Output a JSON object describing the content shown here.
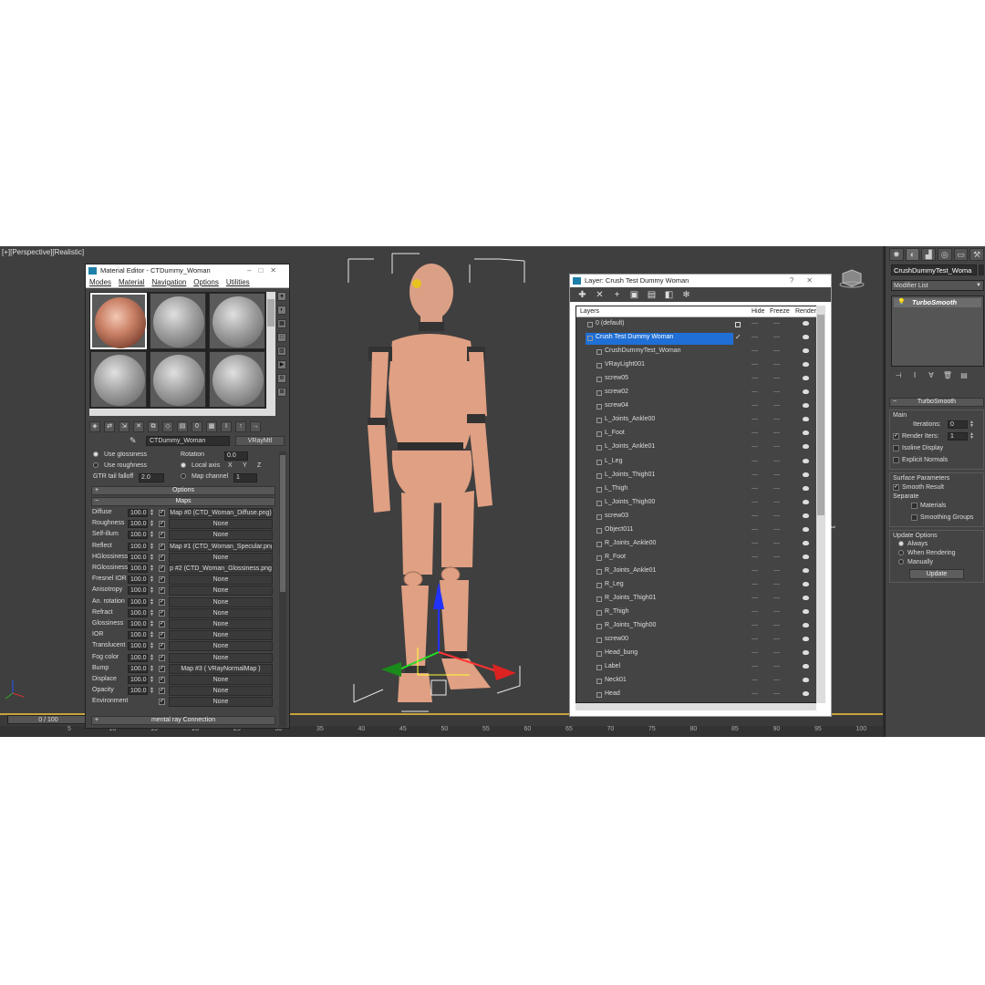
{
  "viewport": {
    "label": "[+][Perspective][Realistic]",
    "frame_counter": "0 / 100",
    "ruler_ticks": [
      "5",
      "10",
      "15",
      "20",
      "25",
      "30",
      "35",
      "40",
      "45",
      "50",
      "55",
      "60",
      "65",
      "70",
      "75",
      "80",
      "85",
      "90",
      "95",
      "100"
    ]
  },
  "command_panel": {
    "tabs": [
      "create-icon",
      "modify-icon",
      "hierarchy-icon",
      "motion-icon",
      "display-icon",
      "utilities-icon"
    ],
    "object_name": "CrushDummyTest_Woma",
    "modifier_list": "Modifier List",
    "stack_item": "TurboSmooth",
    "turbosmooth": {
      "title": "TurboSmooth",
      "main_label": "Main",
      "iterations_label": "Iterations:",
      "iterations_value": "0",
      "render_iters_label": "Render Iters:",
      "render_iters_value": "1",
      "isoline_label": "Isoline Display",
      "explicit_label": "Explicit Normals",
      "surface_label": "Surface Parameters",
      "smooth_result_label": "Smooth Result",
      "separate_label": "Separate",
      "materials_label": "Materials",
      "smoothing_groups_label": "Smoothing Groups",
      "update_options_label": "Update Options",
      "always_label": "Always",
      "when_rendering_label": "When Rendering",
      "manually_label": "Manually",
      "update_button": "Update"
    }
  },
  "material_editor": {
    "title": "Material Editor - CTDummy_Woman",
    "menu": [
      "Modes",
      "Material",
      "Navigation",
      "Options",
      "Utilities"
    ],
    "material_name": "CTDummy_Woman",
    "material_type": "VRayMtl",
    "use_glossiness": "Use glossiness",
    "use_roughness": "Use roughness",
    "rotation_label": "Rotation",
    "rotation_value": "0.0",
    "local_axis": "Local axis",
    "axes": [
      "X",
      "Y",
      "Z"
    ],
    "gtr_label": "GTR tail falloff",
    "gtr_value": "2.0",
    "map_channel_label": "Map channel",
    "map_channel_value": "1",
    "options_rollout": "Options",
    "maps_rollout": "Maps",
    "next_rollout": "mental ray Connection",
    "maps": [
      {
        "label": "Diffuse",
        "amount": "100.0",
        "map": "Map #0 (CTD_Woman_Diffuse.png)"
      },
      {
        "label": "Roughness",
        "amount": "100.0",
        "map": "None"
      },
      {
        "label": "Self-illum",
        "amount": "100.0",
        "map": "None"
      },
      {
        "label": "Reflect",
        "amount": "100.0",
        "map": "Map #1 (CTD_Woman_Specular.png)"
      },
      {
        "label": "HGlossiness",
        "amount": "100.0",
        "map": "None"
      },
      {
        "label": "RGlossiness",
        "amount": "100.0",
        "map": "p #2 (CTD_Woman_Glossiness.png)"
      },
      {
        "label": "Fresnel IOR",
        "amount": "100.0",
        "map": "None"
      },
      {
        "label": "Anisotropy",
        "amount": "100.0",
        "map": "None"
      },
      {
        "label": "An. rotation",
        "amount": "100.0",
        "map": "None"
      },
      {
        "label": "Refract",
        "amount": "100.0",
        "map": "None"
      },
      {
        "label": "Glossiness",
        "amount": "100.0",
        "map": "None"
      },
      {
        "label": "IOR",
        "amount": "100.0",
        "map": "None"
      },
      {
        "label": "Translucent",
        "amount": "100.0",
        "map": "None"
      },
      {
        "label": "Fog color",
        "amount": "100.0",
        "map": "None"
      },
      {
        "label": "Bump",
        "amount": "100.0",
        "map": "Map #3 ( VRayNormalMap )"
      },
      {
        "label": "Displace",
        "amount": "100.0",
        "map": "None"
      },
      {
        "label": "Opacity",
        "amount": "100.0",
        "map": "None"
      },
      {
        "label": "Environment",
        "amount": "",
        "map": "None"
      }
    ]
  },
  "layer_explorer": {
    "title": "Layer: Crush Test Dummy Woman",
    "columns": {
      "layers": "Layers",
      "hide": "Hide",
      "freeze": "Freeze",
      "render": "Render"
    },
    "placeholder_dash": "—",
    "rows": [
      {
        "name": "0 (default)",
        "indent": 1,
        "selected": false
      },
      {
        "name": "Crush Test Dummy Woman",
        "indent": 1,
        "selected": true
      },
      {
        "name": "CrushDummyTest_Woman",
        "indent": 2,
        "selected": false
      },
      {
        "name": "VRayLight001",
        "indent": 2,
        "selected": false
      },
      {
        "name": "screw05",
        "indent": 2,
        "selected": false
      },
      {
        "name": "screw02",
        "indent": 2,
        "selected": false
      },
      {
        "name": "screw04",
        "indent": 2,
        "selected": false
      },
      {
        "name": "L_Joints_Ankle00",
        "indent": 2,
        "selected": false
      },
      {
        "name": "L_Foot",
        "indent": 2,
        "selected": false
      },
      {
        "name": "L_Joints_Ankle01",
        "indent": 2,
        "selected": false
      },
      {
        "name": "L_Leg",
        "indent": 2,
        "selected": false
      },
      {
        "name": "L_Joints_Thigh01",
        "indent": 2,
        "selected": false
      },
      {
        "name": "L_Thigh",
        "indent": 2,
        "selected": false
      },
      {
        "name": "L_Joints_Thigh00",
        "indent": 2,
        "selected": false
      },
      {
        "name": "screw03",
        "indent": 2,
        "selected": false
      },
      {
        "name": "Object011",
        "indent": 2,
        "selected": false
      },
      {
        "name": "R_Joints_Ankle00",
        "indent": 2,
        "selected": false
      },
      {
        "name": "R_Foot",
        "indent": 2,
        "selected": false
      },
      {
        "name": "R_Joints_Ankle01",
        "indent": 2,
        "selected": false
      },
      {
        "name": "R_Leg",
        "indent": 2,
        "selected": false
      },
      {
        "name": "R_Joints_Thigh01",
        "indent": 2,
        "selected": false
      },
      {
        "name": "R_Thigh",
        "indent": 2,
        "selected": false
      },
      {
        "name": "R_Joints_Thigh00",
        "indent": 2,
        "selected": false
      },
      {
        "name": "screw00",
        "indent": 2,
        "selected": false
      },
      {
        "name": "Head_bung",
        "indent": 2,
        "selected": false
      },
      {
        "name": "Label",
        "indent": 2,
        "selected": false
      },
      {
        "name": "Neck01",
        "indent": 2,
        "selected": false
      },
      {
        "name": "Head",
        "indent": 2,
        "selected": false
      }
    ]
  },
  "colors": {
    "viewport_bg": "#3f3f3f",
    "panel_bg": "#444444",
    "selection": "#1f6fd6",
    "skin": "#e0a083",
    "viewport_border": "#c9a438"
  }
}
